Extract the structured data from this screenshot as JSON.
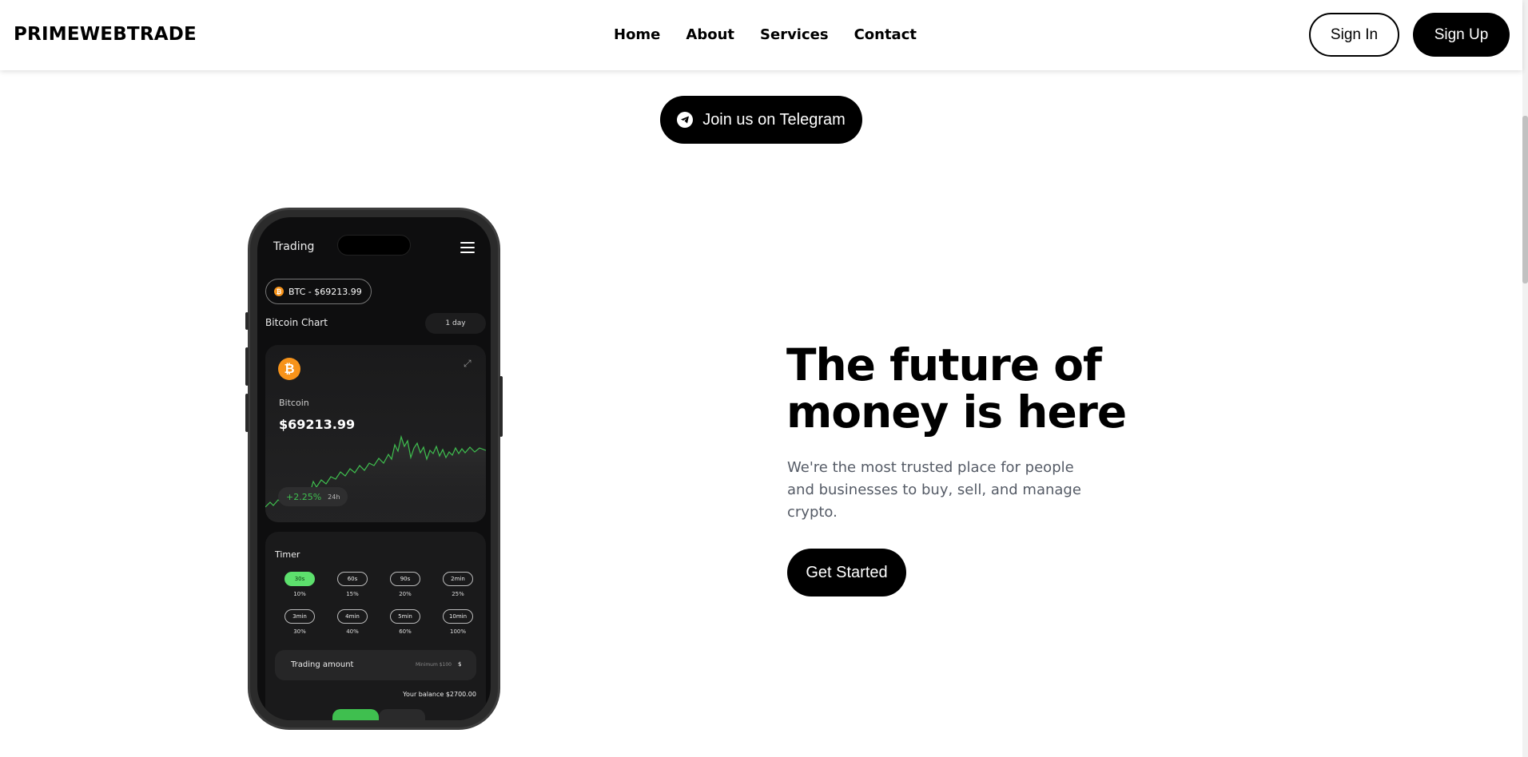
{
  "brand": "PRIMEWEBTRADE",
  "nav": {
    "items": [
      "Home",
      "About",
      "Services",
      "Contact"
    ]
  },
  "auth": {
    "signin": "Sign In",
    "signup": "Sign Up"
  },
  "telegram": {
    "label": "Join us on Telegram",
    "icon": "telegram-icon"
  },
  "hero": {
    "title_line1": "The future of",
    "title_line2": "money is here",
    "subtitle": "We're the most trusted place for people and businesses to buy, sell, and manage crypto.",
    "cta": "Get Started"
  },
  "phone": {
    "screen_title": "Trading",
    "pair": "BTC - $69213.99",
    "chart_label": "Bitcoin Chart",
    "range": "1 day",
    "coin_name": "Bitcoin",
    "coin_price": "$69213.99",
    "change": "+2.25%",
    "change_period": "24h",
    "timer_title": "Timer",
    "timers": [
      {
        "label": "30s",
        "pct": "10%",
        "active": true
      },
      {
        "label": "60s",
        "pct": "15%",
        "active": false
      },
      {
        "label": "90s",
        "pct": "20%",
        "active": false
      },
      {
        "label": "2min",
        "pct": "25%",
        "active": false
      },
      {
        "label": "3min",
        "pct": "30%",
        "active": false
      },
      {
        "label": "4min",
        "pct": "40%",
        "active": false
      },
      {
        "label": "5min",
        "pct": "60%",
        "active": false
      },
      {
        "label": "10min",
        "pct": "100%",
        "active": false
      }
    ],
    "amount_label": "Trading amount",
    "amount_min": "Minimum $100",
    "amount_currency": "$",
    "balance": "Your balance $2700.00"
  },
  "colors": {
    "accent": "#000000",
    "positive": "#3fbf4f",
    "bitcoin": "#f7931a",
    "timer_active": "#5de06d"
  }
}
